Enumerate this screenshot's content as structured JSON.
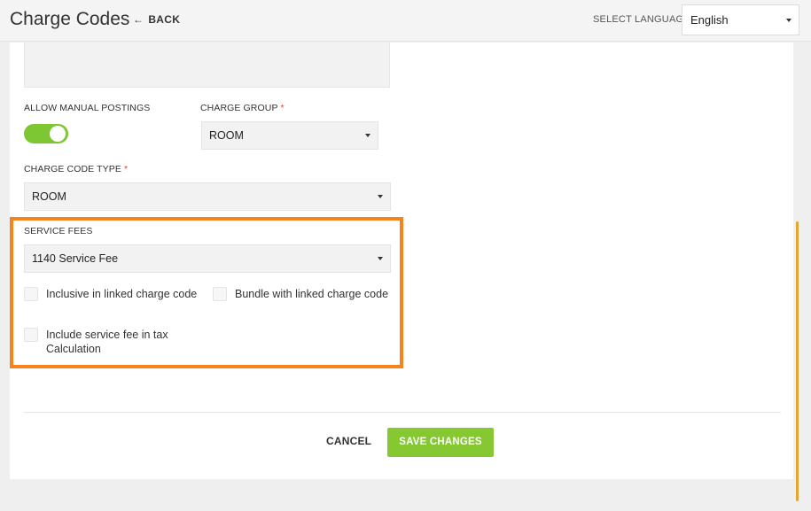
{
  "header": {
    "title": "Charge Codes",
    "back_label": "BACK",
    "language_label": "SELECT LANGUAGE",
    "language_value": "English"
  },
  "form": {
    "allow_manual_postings_label": "ALLOW MANUAL POSTINGS",
    "allow_manual_postings_on": true,
    "charge_group_label": "CHARGE GROUP",
    "charge_group_value": "ROOM",
    "charge_code_type_label": "CHARGE CODE TYPE",
    "charge_code_type_value": "ROOM",
    "required_marker": "*",
    "service_fees": {
      "label": "SERVICE FEES",
      "value": "1140 Service Fee",
      "inclusive_label": "Inclusive in linked charge code",
      "bundle_label": "Bundle with linked charge code",
      "include_tax_line1": "Include service fee in tax",
      "include_tax_line2": "Calculation"
    }
  },
  "actions": {
    "cancel_label": "CANCEL",
    "save_label": "SAVE CHANGES"
  },
  "colors": {
    "toggle_on": "#7dc832",
    "save_button": "#85c832",
    "highlight_border": "#f5841f",
    "required": "#e0403a"
  }
}
